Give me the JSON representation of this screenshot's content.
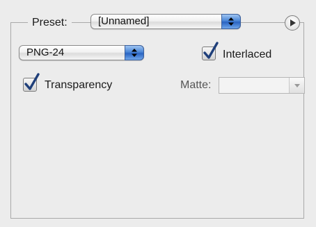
{
  "preset": {
    "label": "Preset:",
    "selected": "[Unnamed]"
  },
  "format": {
    "selected": "PNG-24"
  },
  "options": {
    "interlaced_label": "Interlaced",
    "interlaced_checked": true,
    "transparency_label": "Transparency",
    "transparency_checked": true,
    "matte_label": "Matte:",
    "matte_value": ""
  },
  "icons": {
    "popup_arrows": "up-down-arrows-icon",
    "menu_button": "play-triangle-icon",
    "checkmark": "checkmark-icon",
    "matte_arrow": "chevron-down-icon"
  },
  "colors": {
    "aqua_blue": "#2a64c2",
    "panel_bg": "#ececec"
  }
}
